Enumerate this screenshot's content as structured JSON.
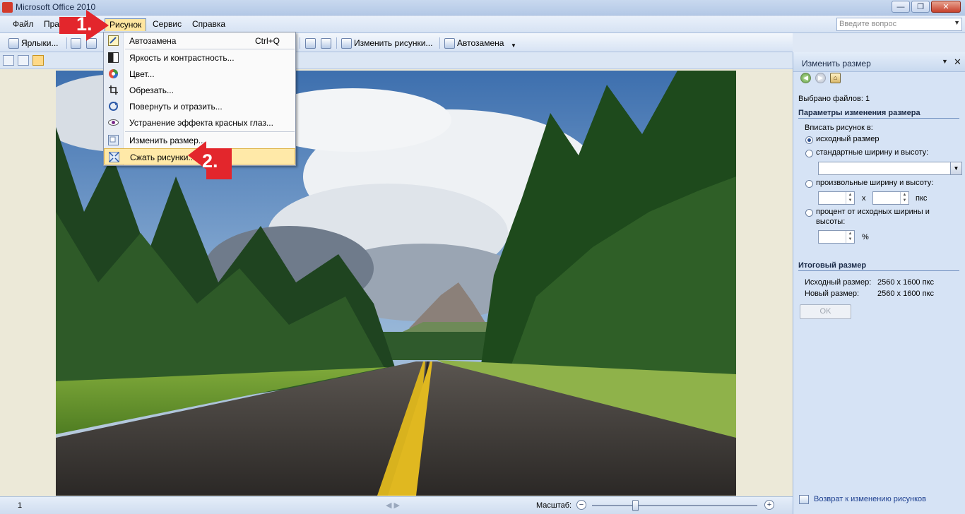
{
  "window": {
    "title": "Microsoft Office 2010",
    "minimize": "—",
    "maximize": "❐",
    "close": "✕"
  },
  "menubar": {
    "items": [
      "Файл",
      "Пра",
      "Рисунок",
      "Сервис",
      "Справка"
    ],
    "ask_placeholder": "Введите вопрос"
  },
  "toolbar": {
    "shortcuts_label": "Ярлыки...",
    "edit_pictures_label": "Изменить рисунки...",
    "autocorrect_label": "Автозамена"
  },
  "picture_menu": {
    "items": [
      {
        "label": "Автозамена",
        "shortcut": "Ctrl+Q"
      },
      {
        "label": "Яркость и контрастность..."
      },
      {
        "label": "Цвет..."
      },
      {
        "label": "Обрезать..."
      },
      {
        "label": "Повернуть и отразить..."
      },
      {
        "label": "Устранение эффекта красных глаз..."
      },
      {
        "label": "Изменить размер..."
      },
      {
        "label": "Сжать рисунки..."
      }
    ]
  },
  "annotations": {
    "step1": "1.",
    "step2": "2.",
    "color": "#e3262c"
  },
  "task_pane": {
    "title": "Изменить размер",
    "selected_files": "Выбрано файлов: 1",
    "resize_params_heading": "Параметры изменения размера",
    "fit_picture_label": "Вписать рисунок в:",
    "options": [
      {
        "label": "исходный размер",
        "selected": true
      },
      {
        "label": "стандартные ширину и высоту:",
        "selected": false
      },
      {
        "label": "произвольные ширину и высоту:",
        "selected": false
      },
      {
        "label": "процент от исходных ширины и",
        "label2": "высоты:",
        "selected": false
      }
    ],
    "times_sign": "x",
    "pixels_unit": "пкс",
    "percent_sign": "%",
    "result_heading": "Итоговый размер",
    "original_size_label": "Исходный размер:",
    "original_size_value": "2560 x 1600 пкс",
    "new_size_label": "Новый размер:",
    "new_size_value": "2560 x 1600 пкс",
    "ok_label": "OK",
    "back_link": "Возврат к изменению рисунков"
  },
  "statusbar": {
    "page": "1",
    "zoom_label": "Масштаб:",
    "zoom_minus": "−",
    "zoom_plus": "+",
    "zoom_level_fraction": 0.26
  },
  "colors": {
    "menu_highlight": "#ffe9a8",
    "task_pane_bg": "#d6e3f5",
    "link": "#1d3f8f"
  }
}
